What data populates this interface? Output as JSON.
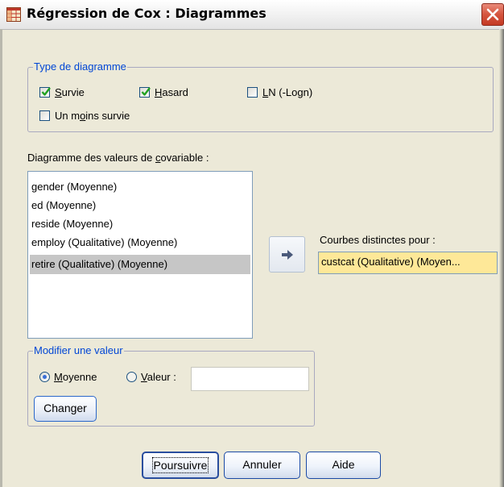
{
  "window": {
    "title": "Régression de Cox : Diagrammes"
  },
  "plot_type": {
    "legend": "Type de diagramme",
    "survival": {
      "pre": "",
      "key": "S",
      "post": "urvie",
      "checked": true
    },
    "hazard": {
      "pre": "",
      "key": "H",
      "post": "asard",
      "checked": true
    },
    "ln": {
      "pre": "",
      "key": "L",
      "post": "N (-Logn)",
      "checked": false
    },
    "one_minus": {
      "pre": "Un m",
      "key": "o",
      "post": "ins survie",
      "checked": false
    }
  },
  "covariates": {
    "label_pre": "Diagramme des valeurs de ",
    "label_key": "c",
    "label_post": "ovariable :",
    "items": [
      "gender (Moyenne)",
      "ed (Moyenne)",
      "reside (Moyenne)",
      "employ (Qualitative) (Moyenne)",
      "retire (Qualitative) (Moyenne)"
    ],
    "selected_index": 4
  },
  "separate_lines": {
    "label": "Courbes distinctes pour :",
    "value": "custcat (Qualitative) (Moyen..."
  },
  "change_value": {
    "legend": "Modifier une valeur",
    "mean": {
      "key": "M",
      "post": "oyenne",
      "selected": true
    },
    "value": {
      "key": "V",
      "post": "aleur :",
      "selected": false
    },
    "value_input": "",
    "change_button": "Changer"
  },
  "buttons": {
    "continue": "Poursuivre",
    "cancel": "Annuler",
    "help": "Aide"
  },
  "icons": {
    "title": "spss-dialog-icon",
    "close": "close-icon",
    "move": "arrow-right-icon",
    "check": "checkmark-icon"
  }
}
